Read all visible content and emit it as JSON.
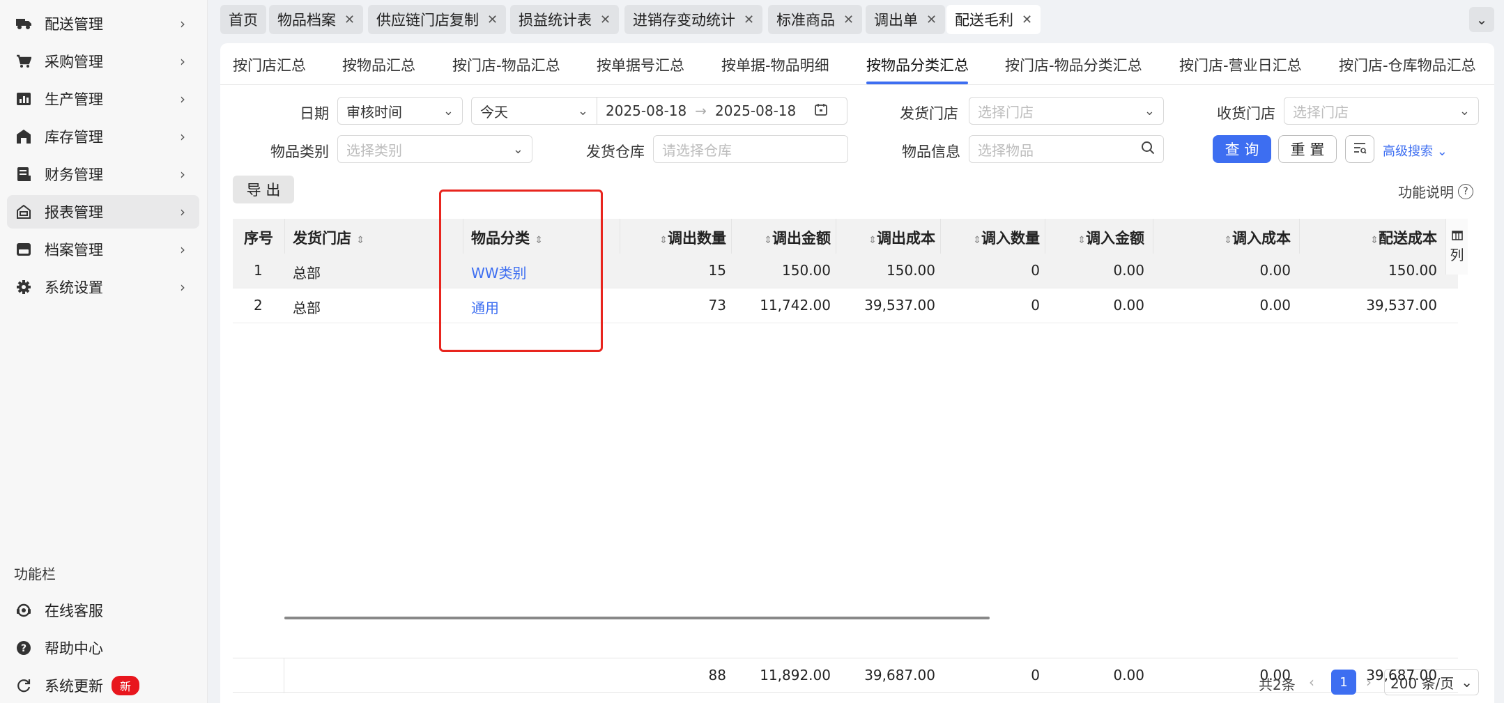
{
  "sidebar": {
    "items": [
      {
        "label": "配送管理",
        "icon": "truck-icon"
      },
      {
        "label": "采购管理",
        "icon": "cart-icon"
      },
      {
        "label": "生产管理",
        "icon": "chart-icon"
      },
      {
        "label": "库存管理",
        "icon": "warehouse-icon"
      },
      {
        "label": "财务管理",
        "icon": "finance-icon"
      },
      {
        "label": "报表管理",
        "icon": "report-icon"
      },
      {
        "label": "档案管理",
        "icon": "archive-icon"
      },
      {
        "label": "系统设置",
        "icon": "gear-icon"
      }
    ],
    "section_title": "功能栏",
    "tools": [
      {
        "label": "在线客服",
        "icon": "support-icon"
      },
      {
        "label": "帮助中心",
        "icon": "help-icon"
      },
      {
        "label": "系统更新",
        "icon": "refresh-icon",
        "badge": "新"
      }
    ]
  },
  "tabs": [
    {
      "label": "首页"
    },
    {
      "label": "物品档案"
    },
    {
      "label": "供应链门店复制"
    },
    {
      "label": "损益统计表"
    },
    {
      "label": "进销存变动统计"
    },
    {
      "label": "标准商品"
    },
    {
      "label": "调出单"
    },
    {
      "label": "配送毛利"
    }
  ],
  "subtabs": [
    "按门店汇总",
    "按物品汇总",
    "按门店-物品汇总",
    "按单据号汇总",
    "按单据-物品明细",
    "按物品分类汇总",
    "按门店-物品分类汇总",
    "按门店-营业日汇总",
    "按门店-仓库物品汇总"
  ],
  "filters": {
    "date_label": "日期",
    "date_type": "审核时间",
    "date_range": "今天",
    "date_start": "2025-08-18",
    "date_end": "2025-08-18",
    "ship_store_label": "发货门店",
    "ship_store_ph": "选择门店",
    "recv_store_label": "收货门店",
    "recv_store_ph": "选择门店",
    "category_label": "物品类别",
    "category_ph": "选择类别",
    "warehouse_label": "发货仓库",
    "warehouse_ph": "请选择仓库",
    "item_label": "物品信息",
    "item_ph": "选择物品",
    "query_btn": "查 询",
    "reset_btn": "重 置",
    "advanced": "高级搜索"
  },
  "toolbar": {
    "export": "导 出",
    "help": "功能说明"
  },
  "table": {
    "columns": [
      "序号",
      "发货门店",
      "物品分类",
      "调出数量",
      "调出金额",
      "调出成本",
      "调入数量",
      "调入金额",
      "调入成本",
      "配送成本"
    ],
    "rows": [
      [
        "1",
        "总部",
        "WW类别",
        "15",
        "150.00",
        "150.00",
        "0",
        "0.00",
        "0.00",
        "150.00"
      ],
      [
        "2",
        "总部",
        "通用",
        "73",
        "11,742.00",
        "39,537.00",
        "0",
        "0.00",
        "0.00",
        "39,537.00"
      ]
    ],
    "totals": [
      "88",
      "11,892.00",
      "39,687.00",
      "0",
      "0.00",
      "0.00",
      "39,687.00"
    ],
    "col_settings": "列"
  },
  "pagination": {
    "total": "共2条",
    "current": "1",
    "page_size": "200 条/页"
  }
}
